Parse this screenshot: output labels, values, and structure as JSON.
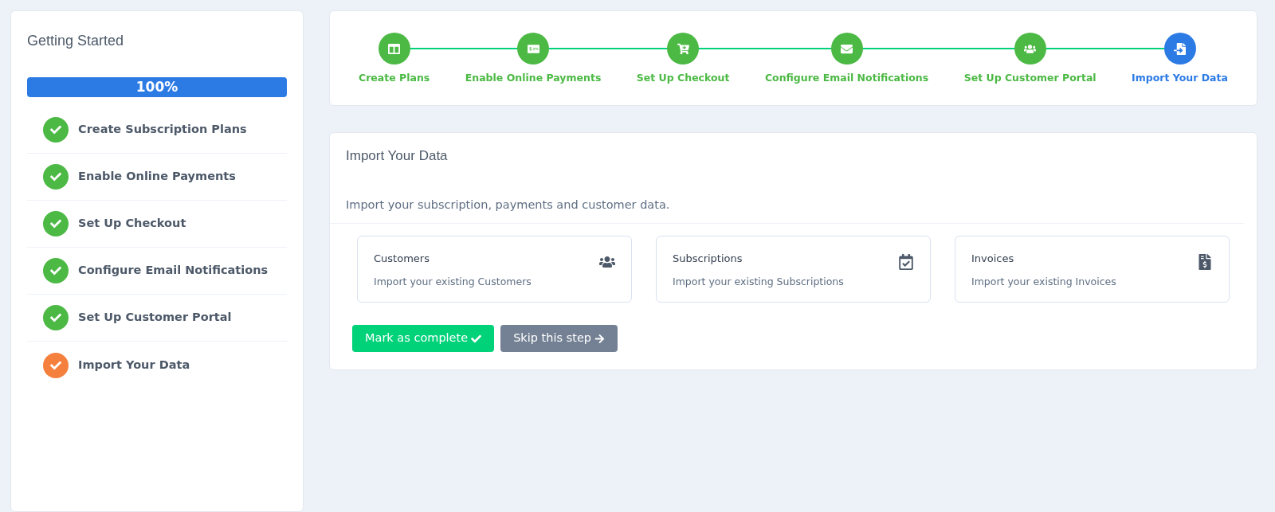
{
  "sidebar": {
    "title": "Getting Started",
    "progress": {
      "level": 1,
      "label": "100%"
    },
    "items": [
      {
        "label": "Create Subscription Plans",
        "checked": true,
        "color": "#4cb944"
      },
      {
        "label": "Enable Online Payments",
        "checked": true,
        "color": "#4cb944"
      },
      {
        "label": "Set Up Checkout",
        "checked": true,
        "color": "#4cb944"
      },
      {
        "label": "Configure Email Notifications",
        "checked": true,
        "color": "#4cb944"
      },
      {
        "label": "Set Up Customer Portal",
        "checked": true,
        "color": "#4cb944"
      },
      {
        "label": "Import Your Data",
        "checked": true,
        "color": "#f5803e"
      }
    ]
  },
  "stepper": [
    {
      "label": "Create Plans",
      "selected": false
    },
    {
      "label": "Enable Online Payments",
      "selected": false
    },
    {
      "label": "Set Up Checkout",
      "selected": false
    },
    {
      "label": "Configure Email Notifications",
      "selected": false
    },
    {
      "label": "Set Up Customer Portal",
      "selected": false
    },
    {
      "label": "Import Your Data",
      "selected": true
    }
  ],
  "panel": {
    "title": "Import Your Data",
    "description": "Import your subscription, payments and customer data.",
    "cards": [
      {
        "title": "Customers",
        "text": "Import your existing Customers"
      },
      {
        "title": "Subscriptions",
        "text": "Import your existing Subscriptions"
      },
      {
        "title": "Invoices",
        "text": "Import your existing Invoices"
      }
    ],
    "buttons": [
      {
        "label": "Mark as complete",
        "kind": "primary"
      },
      {
        "label": "Skip this step",
        "kind": "secondary"
      }
    ]
  }
}
